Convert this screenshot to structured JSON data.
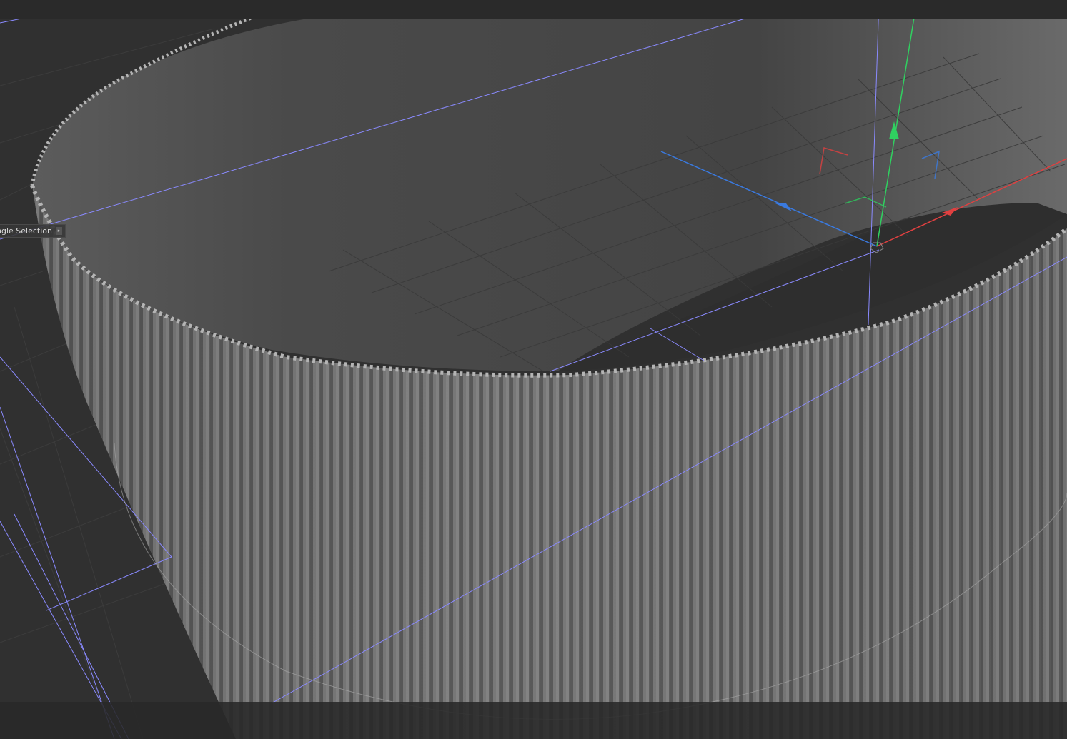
{
  "viewport": {
    "tool_label": "Single Selection",
    "tool_label_visible": "ngle Selection",
    "tool_label_arrow": "▸"
  },
  "colors": {
    "background": "#303030",
    "object_surface": "#6e6e6e",
    "object_rim": "#b0b0b0",
    "bounding_lines": "#8a8aff",
    "grid": "#3f3f3f",
    "axis_x": "#e04040",
    "axis_y": "#30d060",
    "axis_z": "#3a7ae0"
  },
  "icons": {
    "gizmo": "move-gizmo-icon",
    "arrow": "chevron-right-icon"
  }
}
